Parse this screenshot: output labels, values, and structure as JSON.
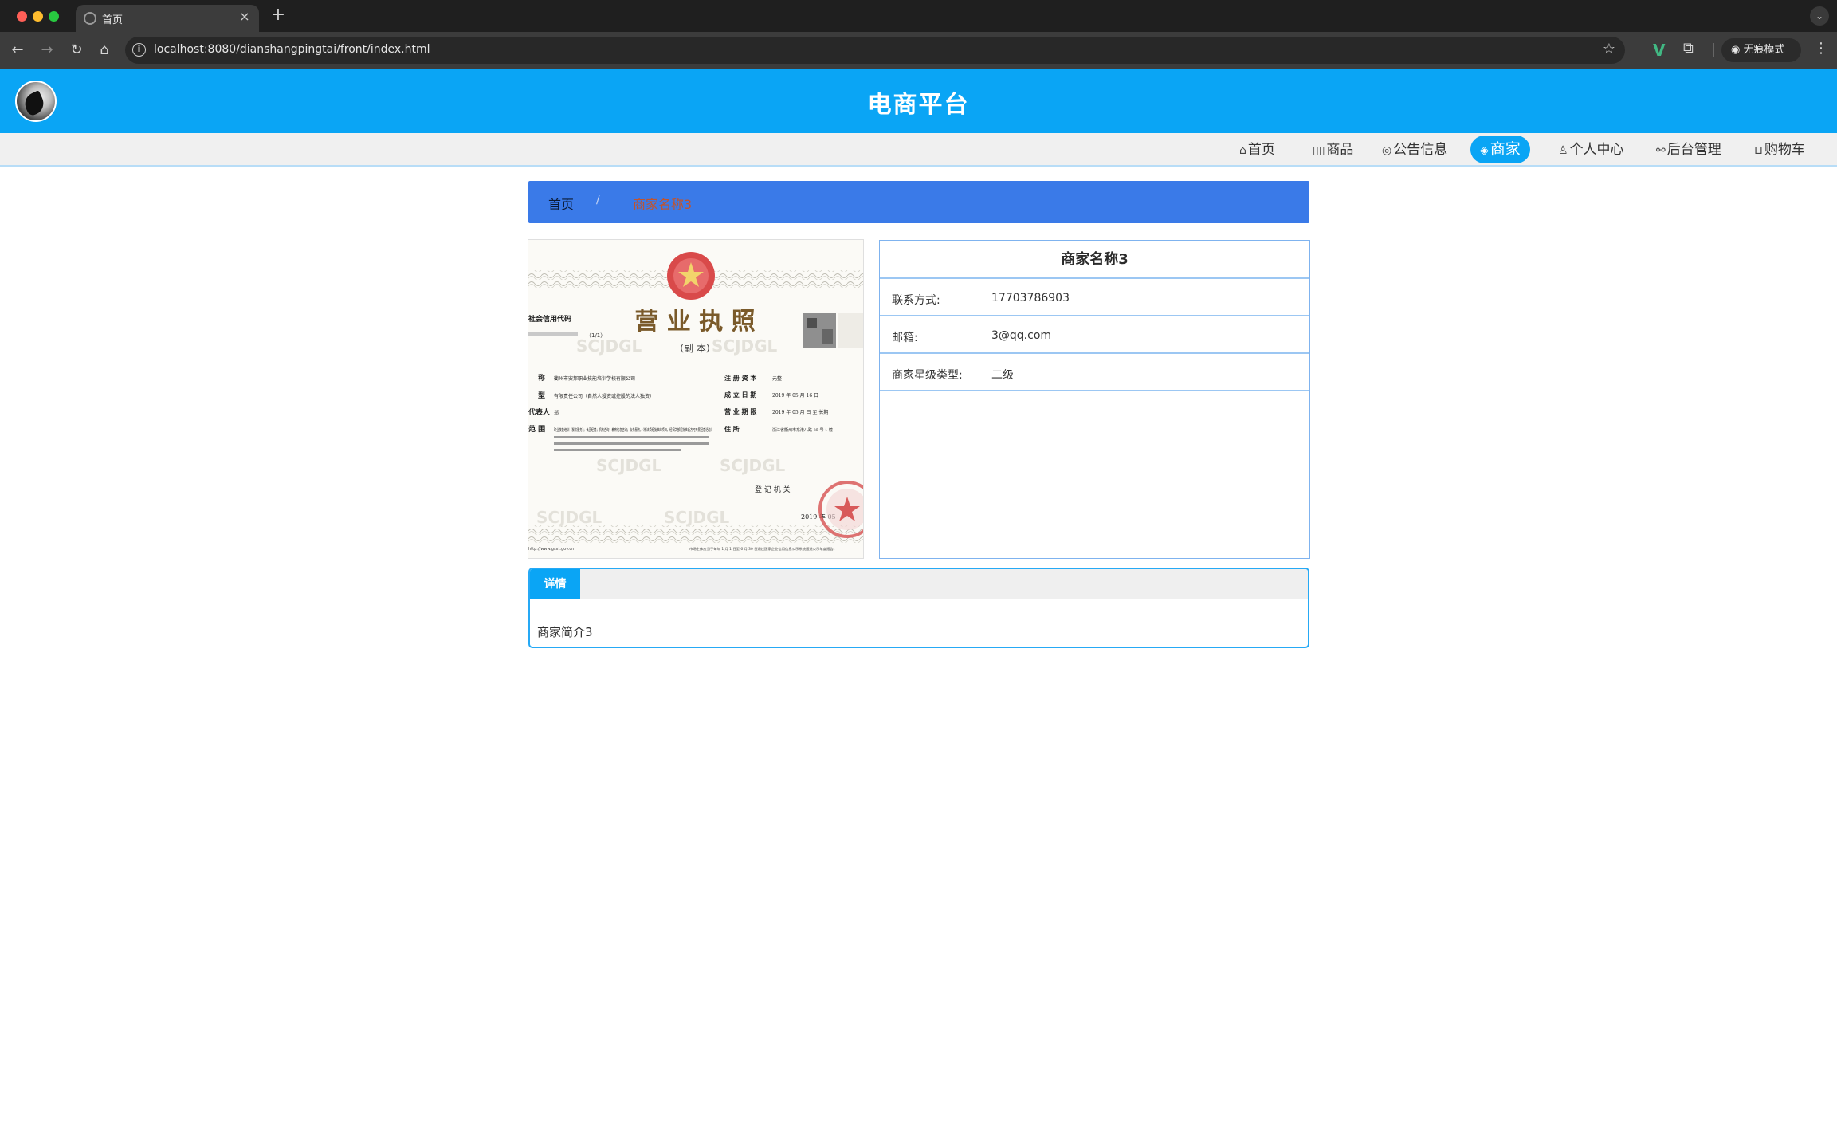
{
  "browser": {
    "tab_title": "首页",
    "tab_close": "×",
    "new_tab": "+",
    "url": "localhost:8080/dianshangpingtai/front/index.html",
    "incognito_label": "无痕模式"
  },
  "site": {
    "title": "电商平台"
  },
  "nav": {
    "items": [
      {
        "icon": "home-icon",
        "label": "首页"
      },
      {
        "icon": "goods-icon",
        "label": "商品"
      },
      {
        "icon": "notice-icon",
        "label": "公告信息"
      },
      {
        "icon": "merchant-icon",
        "label": "商家",
        "active": true
      },
      {
        "icon": "user-icon",
        "label": "个人中心"
      },
      {
        "icon": "link-icon",
        "label": "后台管理"
      },
      {
        "icon": "cart-icon",
        "label": "购物车"
      }
    ]
  },
  "breadcrumb": {
    "home": "首页",
    "separator": "/",
    "current": "商家名称3"
  },
  "license_image": {
    "heading": "营 业 执 照",
    "subheading": "（副 本）",
    "credit_code_label": "社会信用代码",
    "copy_no": "（1/1）",
    "fields": [
      {
        "label": "称",
        "value": "衢州市安邦职业技能培训学校有限公司"
      },
      {
        "label": "型",
        "value": "有限责任公司（自然人投资或控股的法人独资）"
      },
      {
        "label": "代表人",
        "value": "郑"
      },
      {
        "label": "范 围",
        "value": "职业技能培训（餐饮服务）；食品经营；机构咨询；教育信息咨询；会务服务。（依法须经批准的项目，经相关部门批准后方可开展经营活动）"
      }
    ],
    "fields_right": [
      {
        "label": "注 册 资 本",
        "value": "元整"
      },
      {
        "label": "成 立 日 期",
        "value": "2019 年 05 月 16 日"
      },
      {
        "label": "营 业 期 限",
        "value": "2019 年 05 月 日 至 长期"
      },
      {
        "label": "住 所",
        "value": "浙江省衢州市东港八路 35 号 1 幢"
      }
    ],
    "authority": "登 记 机 关",
    "date": "2019 年 05",
    "watermark": "SCJDGL",
    "footer_left": "http://www.gsxt.gov.cn",
    "footer_mid": "市场主体应当于每年 1 月 1 日至 6 月 30 日通过国家企业信用信息公示系统报送公示年度报告。"
  },
  "merchant": {
    "name": "商家名称3",
    "rows": [
      {
        "label": "联系方式:",
        "value": "17703786903"
      },
      {
        "label": "邮箱:",
        "value": "3@qq.com"
      },
      {
        "label": "商家星级类型:",
        "value": "二级"
      }
    ]
  },
  "detail": {
    "tab_label": "详情",
    "content": "商家简介3"
  }
}
